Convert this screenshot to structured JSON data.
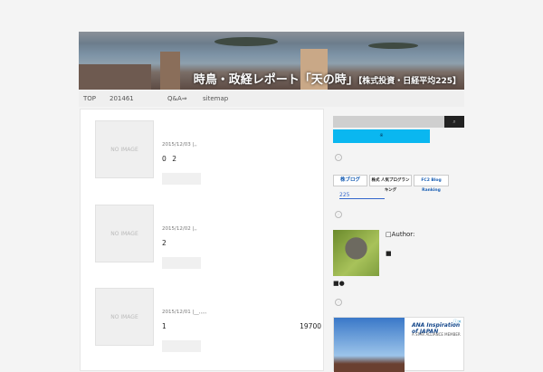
{
  "header": {
    "title": "時鳥・政経レポート「天の時」",
    "subtitle": "【株式投資・日経平均225】"
  },
  "nav": [
    {
      "label": "TOP"
    },
    {
      "label": "201461"
    },
    {
      "label": "Q&A⇒"
    },
    {
      "label": "sitemap"
    }
  ],
  "posts": [
    {
      "thumb": "NO IMAGE",
      "date": "2015/12/03 |,,",
      "excerpt": "0",
      "excerpt_right": "2"
    },
    {
      "thumb": "NO IMAGE",
      "date": "2015/12/02 |,,",
      "excerpt": "2",
      "excerpt_right": ""
    },
    {
      "thumb": "NO IMAGE",
      "date": "2015/12/01 |__,,,,,",
      "excerpt": "1",
      "excerpt_right": "19700"
    }
  ],
  "sidebar": {
    "search_icon": "magnifier-icon",
    "search_button": "⌕",
    "blue_button": "※",
    "banners": [
      "株ブログ",
      "株式 人気ブログランキング",
      "FC2 Blog Ranking"
    ],
    "link": "225",
    "author_label": "□Author:",
    "author_mark": "■",
    "author_marks2": "■●",
    "ad": {
      "brand": "ANA Inspiration of JAPAN",
      "tagline": "A STAR ALLIANCE MEMBER",
      "close": "ⓘ✕"
    }
  },
  "colors": {
    "accent": "#0ab7f0"
  }
}
